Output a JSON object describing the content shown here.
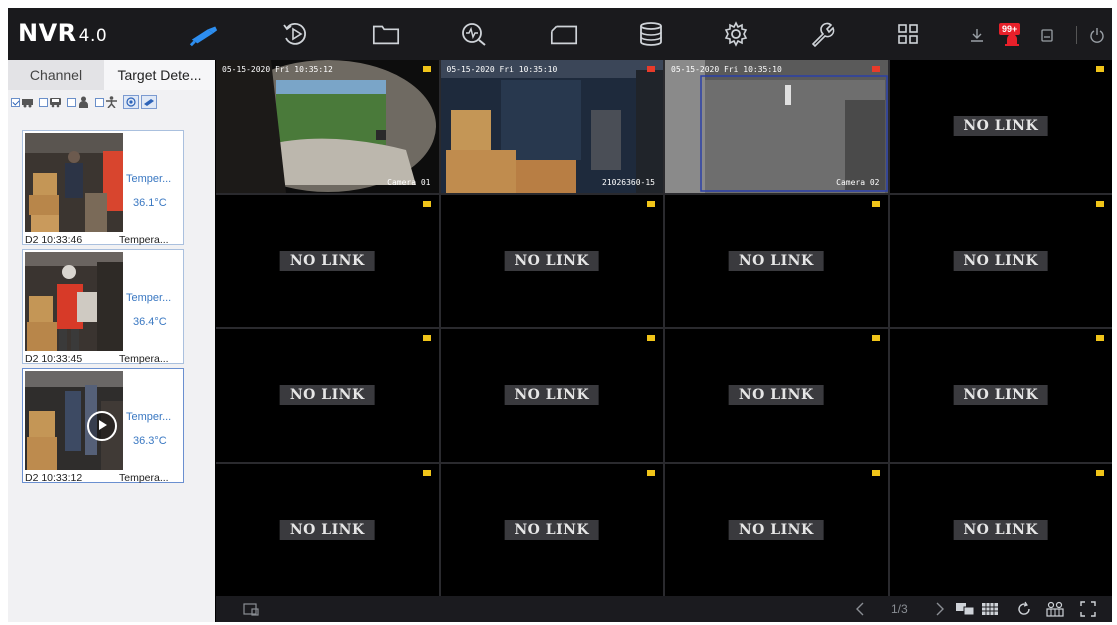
{
  "header": {
    "logo_text": "NVR",
    "logo_version": "4.0",
    "nav_icons": [
      "camera-icon",
      "playback-icon",
      "folder-icon",
      "smart-analysis-icon",
      "monitor-icon",
      "storage-icon",
      "settings-gear-icon",
      "maintenance-wrench-icon",
      "layout-grid-icon"
    ],
    "right_icons": [
      "download-icon",
      "alarm-icon",
      "lock-icon",
      "power-icon"
    ],
    "alarm_badge": "99+"
  },
  "sidebar": {
    "tabs": [
      "Channel",
      "Target Dete..."
    ],
    "filters": [
      {
        "icon": "vehicle-icon",
        "checked": true
      },
      {
        "icon": "car-icon",
        "checked": false
      },
      {
        "icon": "person-icon",
        "checked": false
      },
      {
        "icon": "human-body-icon",
        "checked": false
      }
    ],
    "cards": [
      {
        "label": "Temper...",
        "temp": "36.1°C",
        "time": "D2 10:33:46",
        "type": "Tempera..."
      },
      {
        "label": "Temper...",
        "temp": "36.4°C",
        "time": "D2 10:33:45",
        "type": "Tempera..."
      },
      {
        "label": "Temper...",
        "temp": "36.3°C",
        "time": "D2 10:33:12",
        "type": "Tempera..."
      }
    ]
  },
  "grid": {
    "cells": [
      {
        "osd": "05-15-2020 Fri 10:35:12",
        "cam": "Camera 01"
      },
      {
        "osd": "05-15-2020 Fri 10:35:10",
        "cam": "21026360-15"
      },
      {
        "osd": "05-15-2020 Fri 10:35:10",
        "cam": "Camera 02"
      },
      {
        "nolink": "NO LINK"
      },
      {
        "nolink": "NO LINK"
      },
      {
        "nolink": "NO LINK"
      },
      {
        "nolink": "NO LINK"
      },
      {
        "nolink": "NO LINK"
      },
      {
        "nolink": "NO LINK"
      },
      {
        "nolink": "NO LINK"
      },
      {
        "nolink": "NO LINK"
      },
      {
        "nolink": "NO LINK"
      },
      {
        "nolink": "NO LINK"
      },
      {
        "nolink": "NO LINK"
      },
      {
        "nolink": "NO LINK"
      },
      {
        "nolink": "NO LINK"
      }
    ]
  },
  "footer": {
    "page": "1/3"
  },
  "colors": {
    "accent": "#3a78c2",
    "rec_indicator": "#f0c419",
    "badge": "#e8202a"
  }
}
